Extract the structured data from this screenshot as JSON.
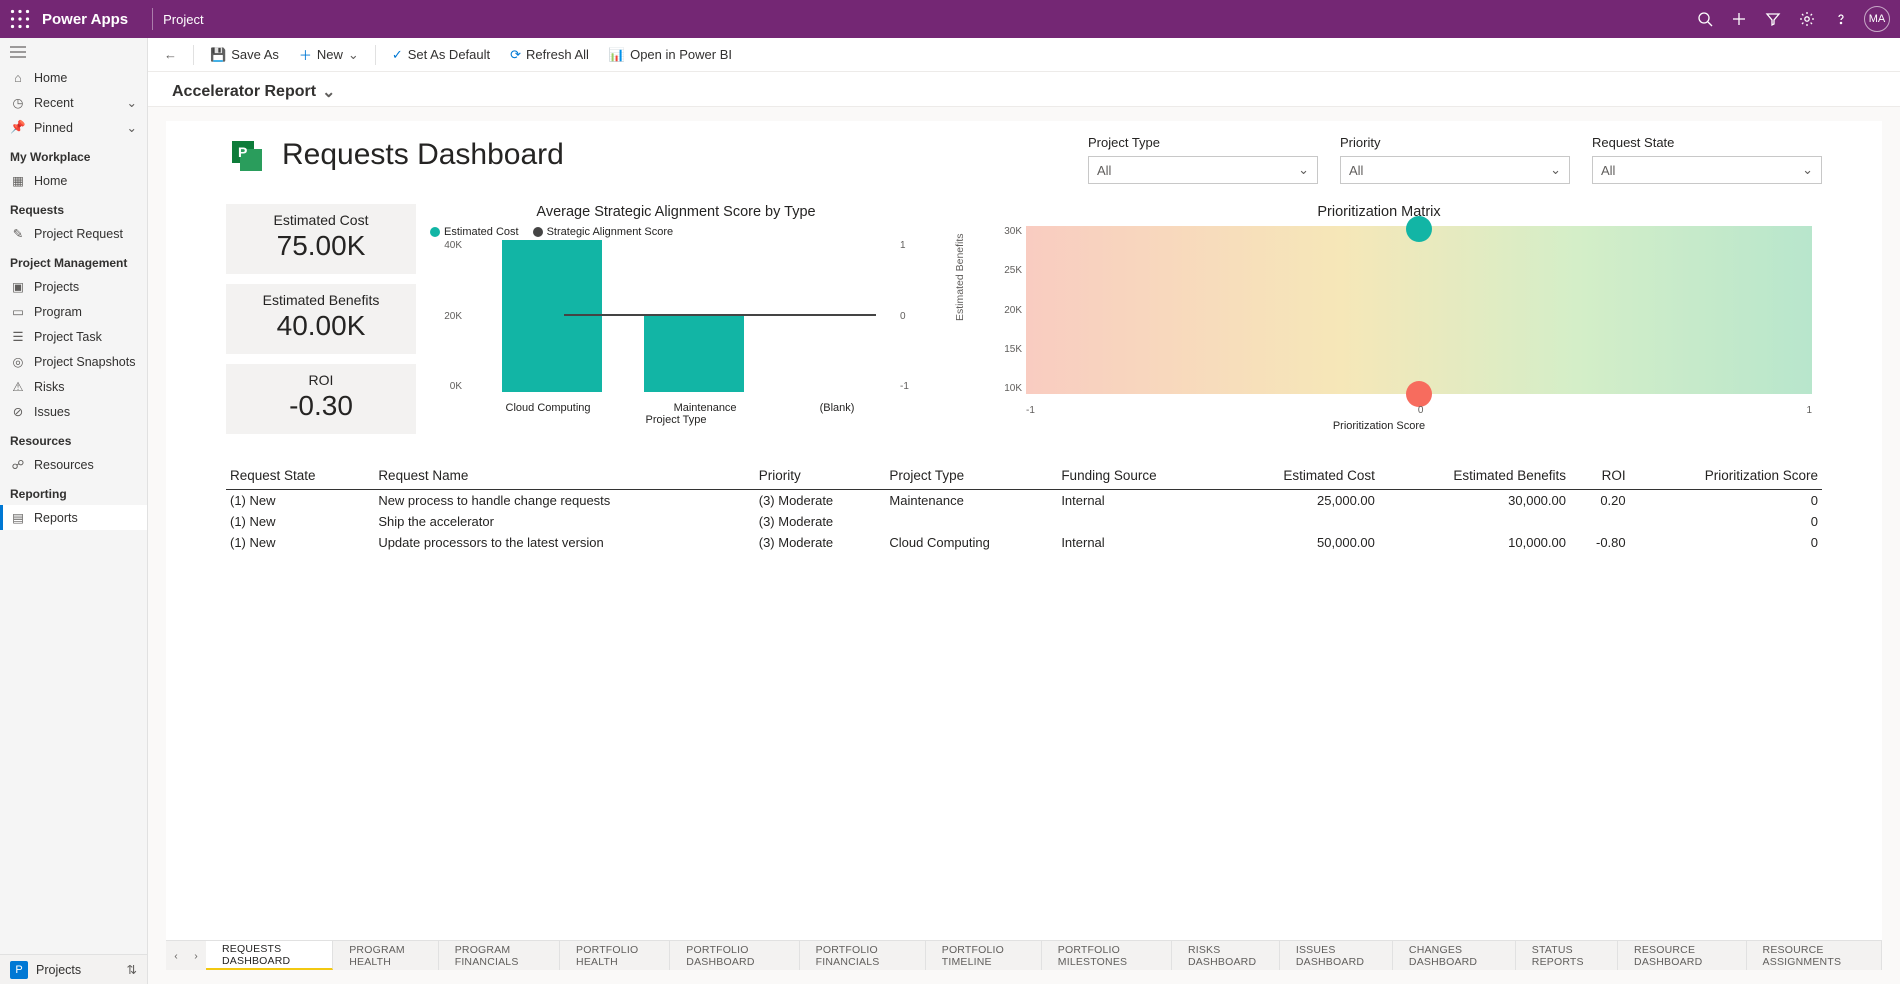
{
  "topbar": {
    "app": "Power Apps",
    "context": "Project",
    "avatar": "MA"
  },
  "leftnav": {
    "home": "Home",
    "recent": "Recent",
    "pinned": "Pinned",
    "sec_myworkplace": "My Workplace",
    "mw_home": "Home",
    "sec_requests": "Requests",
    "rq_projectrequest": "Project Request",
    "sec_pm": "Project Management",
    "pm_projects": "Projects",
    "pm_program": "Program",
    "pm_task": "Project Task",
    "pm_snap": "Project Snapshots",
    "pm_risks": "Risks",
    "pm_issues": "Issues",
    "sec_resources": "Resources",
    "rs_resources": "Resources",
    "sec_reporting": "Reporting",
    "rp_reports": "Reports"
  },
  "cmdbar": {
    "saveas": "Save As",
    "new": "New",
    "setdefault": "Set As Default",
    "refresh": "Refresh All",
    "openbi": "Open in Power BI"
  },
  "page": {
    "title": "Accelerator Report",
    "dashtitle": "Requests Dashboard"
  },
  "slicers": {
    "type_label": "Project Type",
    "type_value": "All",
    "priority_label": "Priority",
    "priority_value": "All",
    "state_label": "Request State",
    "state_value": "All"
  },
  "kpi": {
    "cost_label": "Estimated Cost",
    "cost_value": "75.00K",
    "ben_label": "Estimated Benefits",
    "ben_value": "40.00K",
    "roi_label": "ROI",
    "roi_value": "-0.30"
  },
  "barheader": {
    "title": "Average Strategic Alignment Score by Type",
    "legend1": "Estimated Cost",
    "legend2": "Strategic Alignment Score",
    "xlabel": "Project Type"
  },
  "matrixheader": {
    "title": "Prioritization Matrix",
    "xlabel": "Prioritization Score",
    "ylabel": "Estimated Benefits"
  },
  "table": {
    "h_state": "Request State",
    "h_name": "Request Name",
    "h_priority": "Priority",
    "h_type": "Project Type",
    "h_fund": "Funding Source",
    "h_cost": "Estimated Cost",
    "h_ben": "Estimated Benefits",
    "h_roi": "ROI",
    "h_pscore": "Prioritization Score",
    "rows": [
      {
        "state": "(1) New",
        "name": "New process to handle change requests",
        "priority": "(3) Moderate",
        "type": "Maintenance",
        "fund": "Internal",
        "cost": "25,000.00",
        "ben": "30,000.00",
        "roi": "0.20",
        "pscore": "0"
      },
      {
        "state": "(1) New",
        "name": "Ship the accelerator",
        "priority": "(3) Moderate",
        "type": "",
        "fund": "",
        "cost": "",
        "ben": "",
        "roi": "",
        "pscore": "0"
      },
      {
        "state": "(1) New",
        "name": "Update processors to the latest version",
        "priority": "(3) Moderate",
        "type": "Cloud Computing",
        "fund": "Internal",
        "cost": "50,000.00",
        "ben": "10,000.00",
        "roi": "-0.80",
        "pscore": "0"
      }
    ]
  },
  "tabs": [
    "REQUESTS DASHBOARD",
    "PROGRAM HEALTH",
    "PROGRAM FINANCIALS",
    "PORTFOLIO HEALTH",
    "PORTFOLIO DASHBOARD",
    "PORTFOLIO FINANCIALS",
    "PORTFOLIO TIMELINE",
    "PORTFOLIO MILESTONES",
    "RISKS DASHBOARD",
    "ISSUES DASHBOARD",
    "CHANGES DASHBOARD",
    "STATUS REPORTS",
    "RESOURCE DASHBOARD",
    "RESOURCE ASSIGNMENTS"
  ],
  "footer": {
    "area": "Projects"
  },
  "colors": {
    "teal": "#12b5a5",
    "coral": "#f76c5e"
  },
  "chart_data": [
    {
      "type": "bar+line",
      "title": "Average Strategic Alignment Score by Type",
      "categories": [
        "Cloud Computing",
        "Maintenance",
        "(Blank)"
      ],
      "series": [
        {
          "name": "Estimated Cost",
          "kind": "bar",
          "values": [
            50000,
            25000,
            null
          ],
          "yaxis": "left"
        },
        {
          "name": "Strategic Alignment Score",
          "kind": "line",
          "values": [
            0,
            0,
            0
          ],
          "yaxis": "right"
        }
      ],
      "y_left": {
        "label": "",
        "ticks": [
          0,
          20000,
          40000
        ],
        "tick_labels": [
          "0K",
          "20K",
          "40K"
        ]
      },
      "y_right": {
        "label": "",
        "ticks": [
          -1,
          0,
          1
        ]
      },
      "xlabel": "Project Type"
    },
    {
      "type": "scatter",
      "title": "Prioritization Matrix",
      "xlabel": "Prioritization Score",
      "ylabel": "Estimated Benefits",
      "xlim": [
        -1,
        1
      ],
      "ylim": [
        10000,
        30000
      ],
      "y_ticks": [
        10000,
        15000,
        20000,
        25000,
        30000
      ],
      "y_tick_labels": [
        "10K",
        "15K",
        "20K",
        "25K",
        "30K"
      ],
      "x_ticks": [
        -1,
        0,
        1
      ],
      "points": [
        {
          "x": 0,
          "y": 30000,
          "color": "#12b5a5"
        },
        {
          "x": 0,
          "y": 10000,
          "color": "#f76c5e"
        }
      ],
      "background": "gradient red-yellow-green"
    }
  ]
}
